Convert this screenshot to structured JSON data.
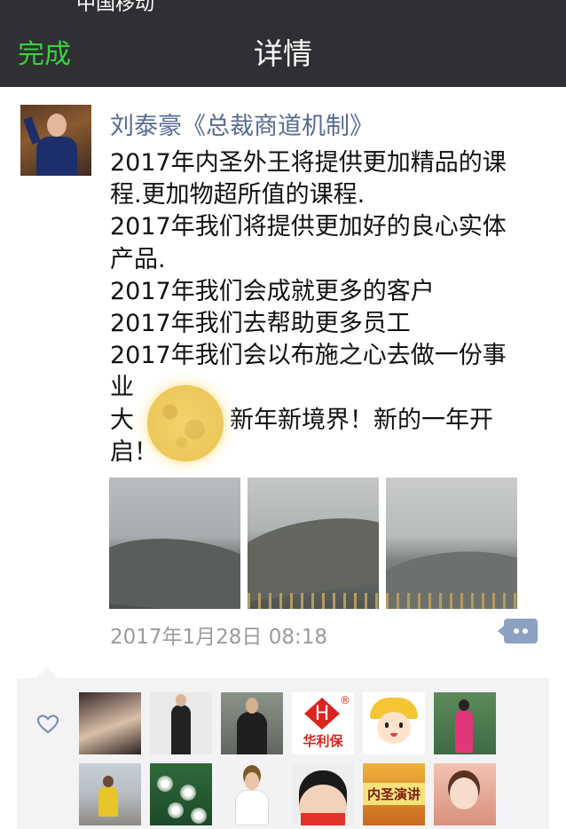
{
  "status_bar": {
    "fragment": "中国移动"
  },
  "navbar": {
    "done_label": "完成",
    "title": "详情"
  },
  "post": {
    "author": "刘泰豪《总裁商道机制》",
    "lines": [
      "2017年内圣外王将提供更加精品的课",
      "程.更加物超所值的课程.",
      "2017年我们将提供更加好的良心实体",
      "产品.",
      "2017年我们会成就更多的客户",
      "2017年我们去帮助更多员工",
      "2017年我们会以布施之心去做一份事",
      "业",
      "大　　　　新年新境界！新的一年开",
      "启！"
    ],
    "timestamp": "2017年1月28日 08:18",
    "photos": [
      "photo-1",
      "photo-2",
      "photo-3"
    ]
  },
  "likes": {
    "icon": "heart-icon",
    "avatars": [
      {
        "name": "liker-avatar-1",
        "text": ""
      },
      {
        "name": "liker-avatar-2",
        "text": ""
      },
      {
        "name": "liker-avatar-3",
        "text": ""
      },
      {
        "name": "liker-avatar-4",
        "text": "华利保",
        "logo": "H",
        "reg": "®"
      },
      {
        "name": "liker-avatar-5",
        "text": ""
      },
      {
        "name": "liker-avatar-6",
        "text": ""
      },
      {
        "name": "liker-avatar-7",
        "text": ""
      },
      {
        "name": "liker-avatar-8",
        "text": ""
      },
      {
        "name": "liker-avatar-9",
        "text": ""
      },
      {
        "name": "liker-avatar-10",
        "text": ""
      },
      {
        "name": "liker-avatar-11",
        "text": "内圣演讲"
      },
      {
        "name": "liker-avatar-12",
        "text": ""
      }
    ]
  },
  "colors": {
    "navbar_bg": "#2e3033",
    "done_green": "#3cd040",
    "author_blue": "#576b95",
    "timestamp_gray": "#9b9b9b",
    "likes_bg": "#f3f3f5"
  }
}
